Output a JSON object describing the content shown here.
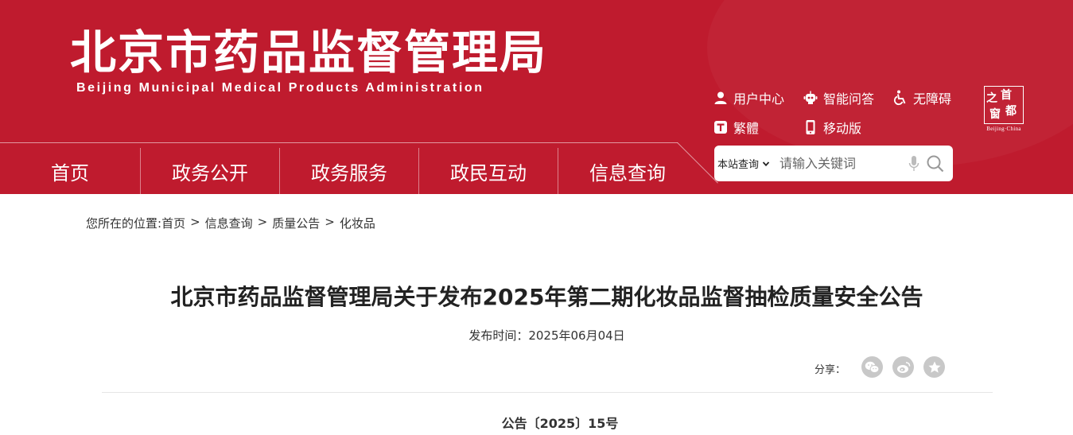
{
  "header": {
    "title": "北京市药品监督管理局",
    "subtitle": "Beijing Municipal Medical Products Administration",
    "toolbar": {
      "user_center": "用户中心",
      "smart_qa": "智能问答",
      "accessibility": "无障碍",
      "traditional": "繁體",
      "mobile": "移动版"
    },
    "capital_logo": {
      "zhi": "之",
      "shou": "首",
      "chuang": "窗",
      "du": "都",
      "english": "Beijing·China"
    }
  },
  "nav": {
    "items": [
      "首页",
      "政务公开",
      "政务服务",
      "政民互动",
      "信息查询"
    ]
  },
  "search": {
    "scope": "本站查询",
    "placeholder": "请输入关键词"
  },
  "breadcrumb": {
    "prefix": "您所在的位置:",
    "items": [
      "首页",
      "信息查询",
      "质量公告",
      "化妆品"
    ],
    "separator": ">"
  },
  "article": {
    "title": "北京市药品监督管理局关于发布2025年第二期化妆品监督抽检质量安全公告",
    "publish_date": "发布时间：2025年06月04日",
    "share_label": "分享：",
    "doc_number": "公告〔2025〕15号"
  },
  "colors": {
    "brand_red": "#bf1b2e",
    "share_icon_bg": "#c8c8c8"
  }
}
